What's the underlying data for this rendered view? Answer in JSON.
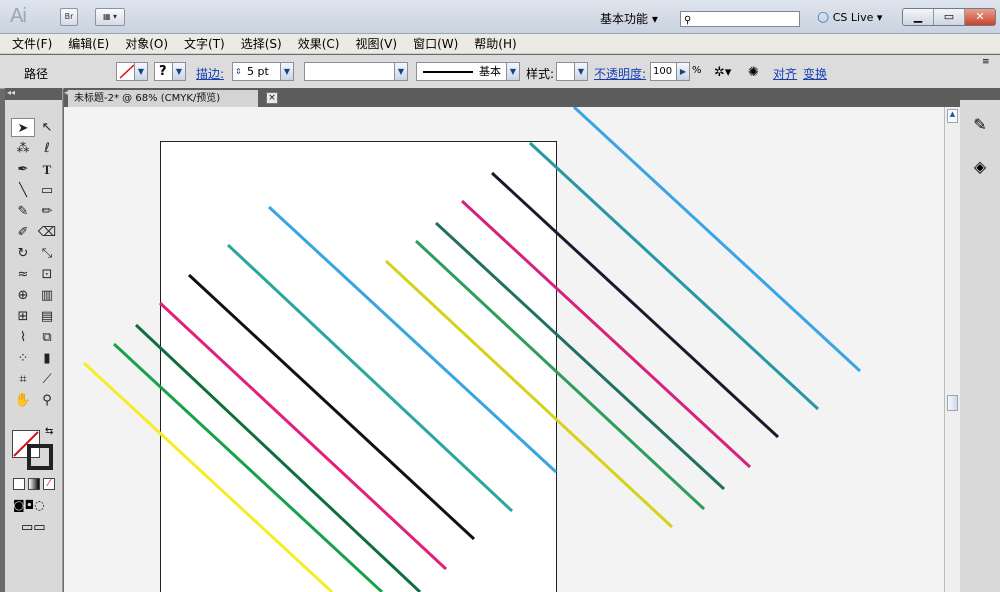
{
  "app": {
    "logo": "Ai",
    "bridge": "Br",
    "workspace": "基本功能",
    "cslive": "CS Live"
  },
  "window": {
    "minimize": "▭",
    "restore": "▭",
    "close": "✕"
  },
  "menu": [
    "文件(F)",
    "编辑(E)",
    "对象(O)",
    "文字(T)",
    "选择(S)",
    "效果(C)",
    "视图(V)",
    "窗口(W)",
    "帮助(H)"
  ],
  "control": {
    "selection": "路径",
    "stroke_label": "描边:",
    "stroke_weight": "5 pt",
    "style_name": "基本",
    "style_label": "样式:",
    "opacity_label": "不透明度:",
    "opacity_value": "100",
    "percent": "%",
    "align": "对齐",
    "transform": "变换",
    "fill_unknown": "?"
  },
  "document": {
    "tab_title": "未标题-2* @ 68% (CMYK/预览)",
    "close": "×"
  },
  "line_colors": [
    "#f6ed24",
    "#17a24a",
    "#0f6e3b",
    "#e0217a",
    "#111111",
    "#2aa79d",
    "#36a5e0",
    "#d6d21c",
    "#2e9d5d",
    "#1f6f62",
    "#d5237b",
    "#1a1a2e",
    "#2697a4",
    "#3aa5e6"
  ]
}
